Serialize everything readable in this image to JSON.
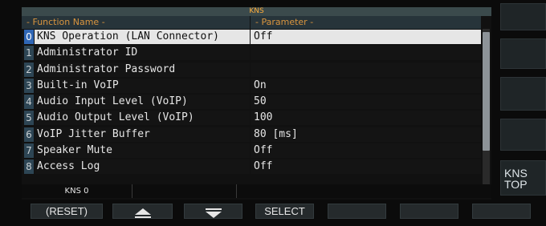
{
  "panel": {
    "title": "KNS",
    "header_function": "- Function Name -",
    "header_parameter": "- Parameter -"
  },
  "rows": [
    {
      "index": "0",
      "name": "KNS Operation (LAN Connector)",
      "value": "Off",
      "selected": true
    },
    {
      "index": "1",
      "name": "Administrator ID",
      "value": ""
    },
    {
      "index": "2",
      "name": "Administrator Password",
      "value": ""
    },
    {
      "index": "3",
      "name": "Built-in VoIP",
      "value": "On"
    },
    {
      "index": "4",
      "name": "Audio Input Level (VoIP)",
      "value": "50"
    },
    {
      "index": "5",
      "name": "Audio Output Level (VoIP)",
      "value": "100"
    },
    {
      "index": "6",
      "name": "VoIP Jitter Buffer",
      "value": "80 [ms]"
    },
    {
      "index": "7",
      "name": "Speaker Mute",
      "value": "Off"
    },
    {
      "index": "8",
      "name": "Access Log",
      "value": "Off"
    }
  ],
  "status": {
    "cell1": "KNS 0",
    "cell2": "",
    "cell3": ""
  },
  "side_keys": {
    "kns_top": "KNS\nTOP"
  },
  "function_keys": {
    "reset": "(RESET)",
    "up_icon": "up-triangle-icon",
    "down_icon": "down-triangle-icon",
    "select": "SELECT"
  },
  "colors": {
    "title_text": "#ffae3b",
    "header_text": "#d9953f",
    "selected_row": "#e6e6e6",
    "selected_index": "#2f66b5",
    "index_bg": "#2d4554"
  }
}
